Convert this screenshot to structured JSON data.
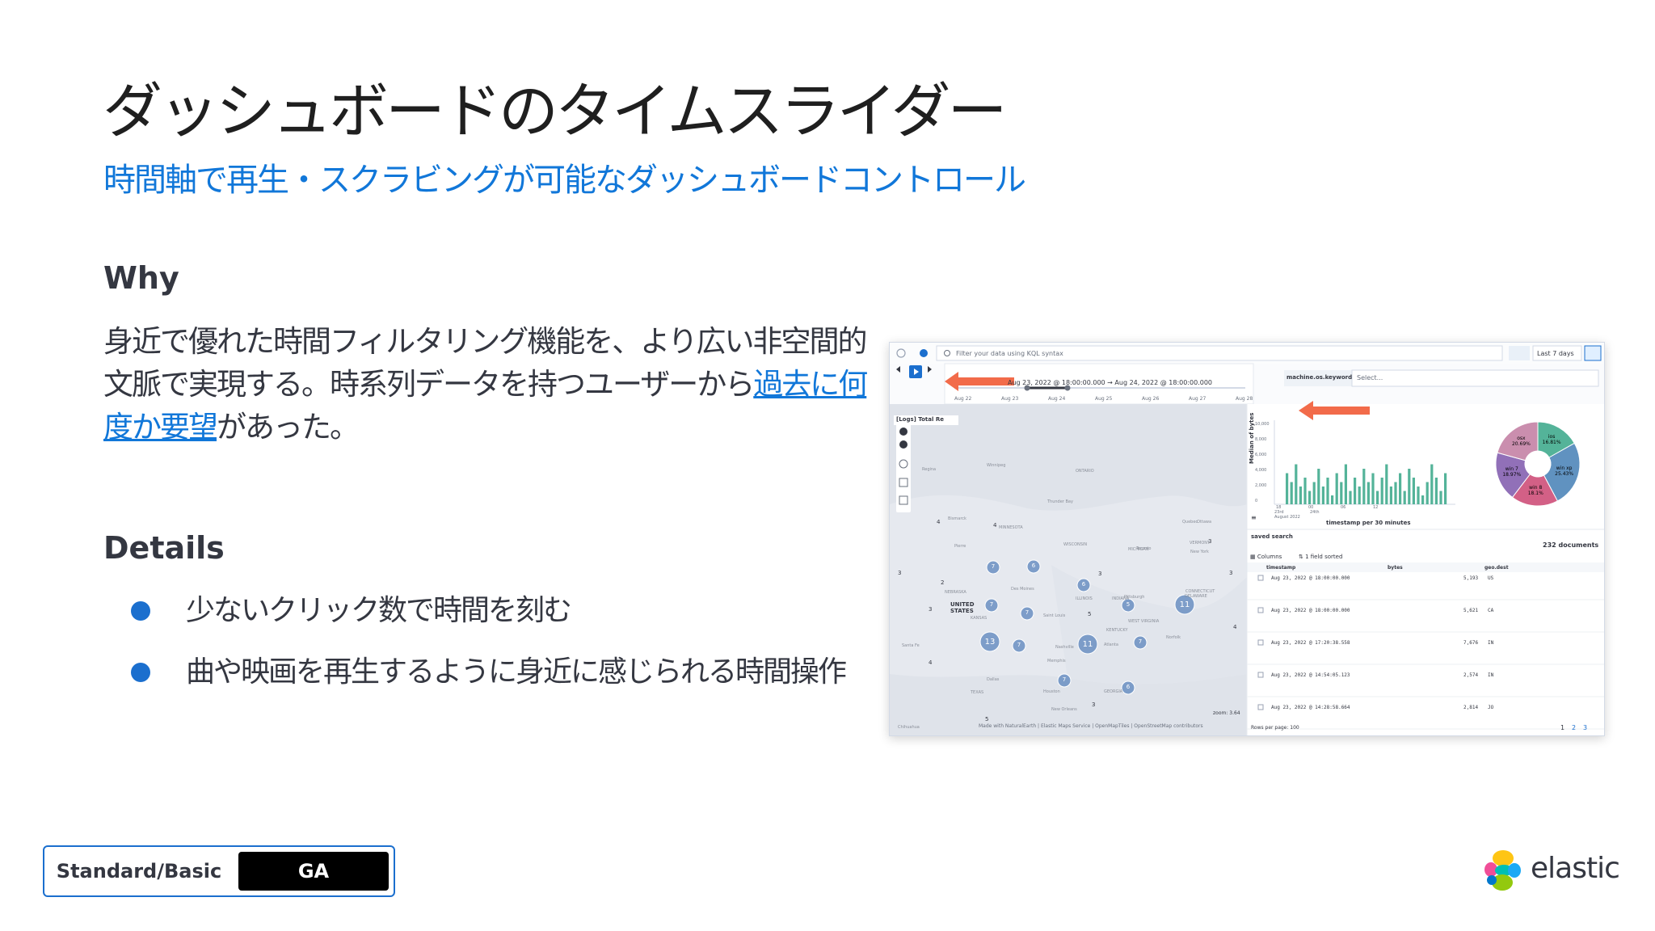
{
  "slide": {
    "title": "ダッシュボードのタイムスライダー",
    "subtitle": "時間軸で再生・スクラビングが可能なダッシュボードコントロール",
    "why_heading": "Why",
    "why_text_1": "身近で優れた時間フィルタリング機能を、より広い非空間的文脈で実現する。時系列データを持つユーザーから",
    "why_link": "過去に何度か要望",
    "why_text_2": "があった。",
    "details_heading": "Details",
    "bullets": [
      "少ないクリック数で時間を刻む",
      "曲や映画を再生するように身近に感じられる時間操作"
    ],
    "badge": {
      "tier": "Standard/Basic",
      "status": "GA"
    },
    "logo_text": "elastic"
  },
  "screenshot": {
    "search_placeholder": "Filter your data using KQL syntax",
    "time_range": "Last 7 days",
    "timeslider_range": "Aug 23, 2022 @ 18:00:00.000 → Aug 24, 2022 @ 18:00:00.000",
    "dates": [
      "Aug 22",
      "Aug 23",
      "Aug 24",
      "Aug 25",
      "Aug 26",
      "Aug 27",
      "Aug 28"
    ],
    "control_label": "machine.os.keyword",
    "control_placeholder": "Select...",
    "map_panel_title": "[Logs] Total Re",
    "map_labels": [
      "UNITED STATES",
      "Winnipeg",
      "Thunder Bay",
      "Ottawa",
      "Toronto",
      "Des Moines",
      "Saint Louis",
      "Nashville",
      "Memphis",
      "Atlanta",
      "Dallas",
      "Houston",
      "New Orleans",
      "Santa Fe",
      "Chihuahua",
      "Bismarck",
      "Pierre",
      "Pittsburgh",
      "Norfolk",
      "New York",
      "Regina",
      "Quebec",
      "MICHIGAN",
      "WISCONSIN",
      "ONTARIO",
      "ILLINOIS",
      "INDIANA",
      "KANSAS",
      "TEXAS",
      "GEORGIA",
      "KENTUCKY",
      "NEBRASKA",
      "MINNESOTA",
      "VERMONT",
      "CONNECTICUT",
      "DELAWARE",
      "WEST VIRGINIA"
    ],
    "map_clusters": [
      "7",
      "6",
      "6",
      "7",
      "7",
      "11",
      "7",
      "13",
      "11",
      "5",
      "7",
      "7",
      "6"
    ],
    "map_small_counts": [
      "4",
      "4",
      "3",
      "2",
      "3",
      "4",
      "5",
      "5",
      "3",
      "3",
      "3",
      "3",
      "4"
    ],
    "map_zoom": "zoom: 3.64",
    "map_attribution": "Made with NaturalEarth  |  Elastic Maps Service  |  OpenMapTiles  |  OpenStreetMap contributors",
    "histogram_xlabel": "timestamp per 30 minutes",
    "histogram_ylabel": "Median of bytes",
    "histogram_yticks": [
      "10,000",
      "8,000",
      "6,000",
      "4,000",
      "2,000",
      "0"
    ],
    "histogram_xticks": [
      "18",
      "00",
      "06",
      "12"
    ],
    "histogram_date_line1": "23rd",
    "histogram_date_line2": "August 2022",
    "histogram_mid_line1": "24th",
    "pie_labels": [
      {
        "name": "ios",
        "value": "16.81%",
        "color": "#54b399"
      },
      {
        "name": "win xp",
        "value": "25.43%",
        "color": "#6092c0"
      },
      {
        "name": "win 8",
        "value": "18.1%",
        "color": "#d36086"
      },
      {
        "name": "win 7",
        "value": "18.97%",
        "color": "#9170b8"
      },
      {
        "name": "osx",
        "value": "20.69%",
        "color": "#ca8eae"
      }
    ],
    "search_title": "saved search",
    "documents": "232 documents",
    "columns_label": "Columns",
    "sorted_label": "1 field sorted",
    "table_headers": [
      "timestamp",
      "bytes",
      "geo.dest"
    ],
    "rows": [
      {
        "ts": "Aug 23, 2022 @ 18:00:00.000",
        "bytes": "5,193",
        "dest": "US"
      },
      {
        "ts": "Aug 23, 2022 @ 18:00:00.000",
        "bytes": "5,621",
        "dest": "CA"
      },
      {
        "ts": "Aug 23, 2022 @ 17:20:38.558",
        "bytes": "7,676",
        "dest": "IN"
      },
      {
        "ts": "Aug 23, 2022 @ 14:54:05.123",
        "bytes": "2,574",
        "dest": "IN"
      },
      {
        "ts": "Aug 23, 2022 @ 14:28:58.664",
        "bytes": "2,814",
        "dest": "JO"
      }
    ],
    "rows_per_page": "Rows per page: 100",
    "pagination": [
      "1",
      "2",
      "3"
    ]
  }
}
